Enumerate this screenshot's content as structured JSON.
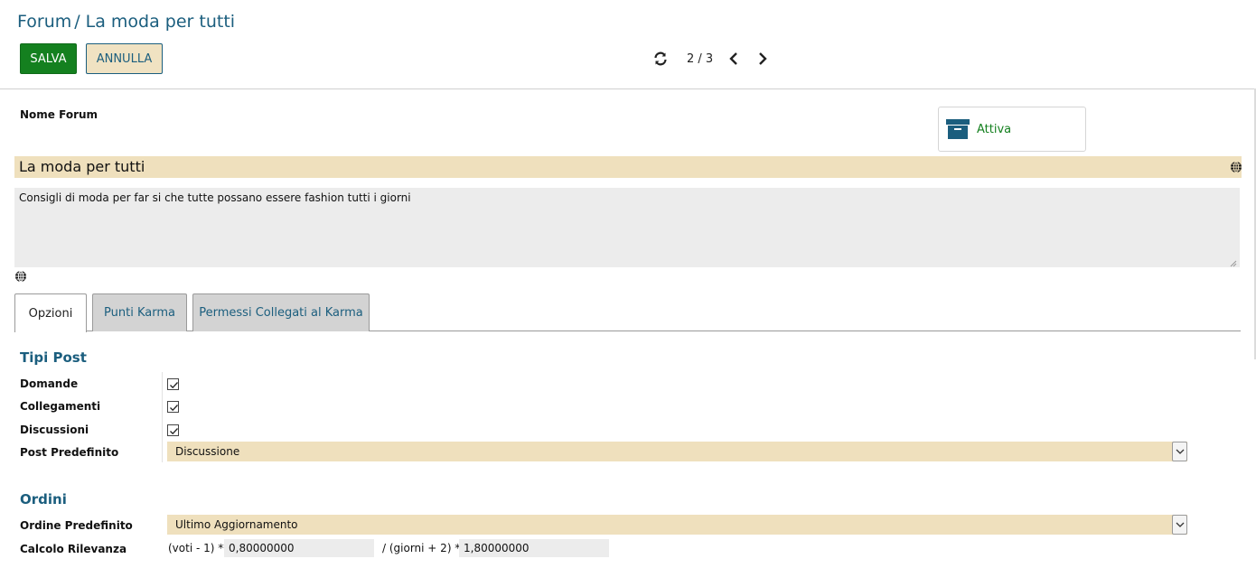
{
  "breadcrumb": {
    "parent": "Forum",
    "separator": "/",
    "current": "La moda per tutti"
  },
  "toolbar": {
    "save_label": "SALVA",
    "cancel_label": "ANNULLA"
  },
  "pager": {
    "counter": "2 / 3"
  },
  "form": {
    "name_label": "Nome Forum",
    "name_value": "La moda per tutti",
    "description": "Consigli di moda per far si che tutte possano essere fashion tutti i giorni",
    "status_label": "Attiva"
  },
  "tabs": [
    {
      "label": "Opzioni",
      "active": true
    },
    {
      "label": "Punti Karma",
      "active": false
    },
    {
      "label": "Permessi Collegati al Karma",
      "active": false
    }
  ],
  "post_types": {
    "title": "Tipi Post",
    "questions_label": "Domande",
    "links_label": "Collegamenti",
    "discussions_label": "Discussioni",
    "default_label": "Post Predefinito",
    "default_value": "Discussione"
  },
  "orders": {
    "title": "Ordini",
    "default_label": "Ordine Predefinito",
    "default_value": "Ultimo Aggiornamento",
    "relevance_label": "Calcolo Rilevanza",
    "votes_formula": "(voti - 1) **",
    "votes_exponent": "0,80000000",
    "days_formula": "/ (giorni + 2) **",
    "days_exponent": "1,80000000"
  },
  "colors": {
    "accent": "#1b5e7e",
    "save": "#14801f",
    "highlight_field": "#efe0bd"
  },
  "icons": [
    "refresh-icon",
    "chevron-left-icon",
    "chevron-right-icon",
    "archive-box-icon",
    "globe-icon",
    "check-icon",
    "caret-down-icon"
  ]
}
